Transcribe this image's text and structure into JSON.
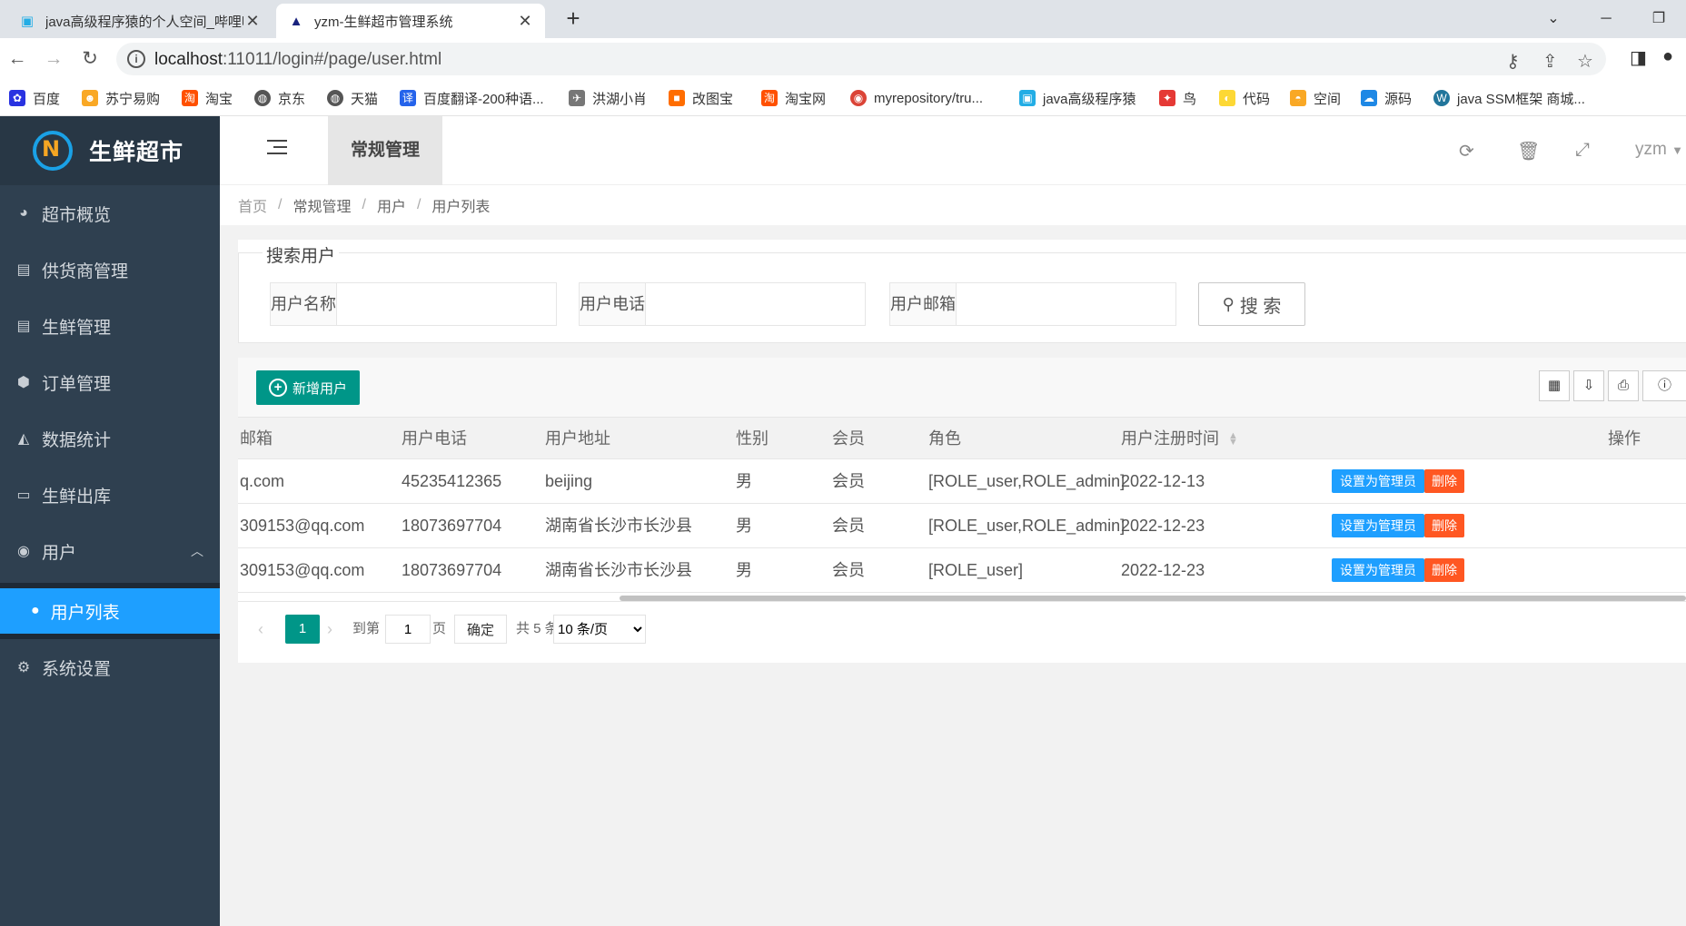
{
  "browser": {
    "tabs": [
      {
        "title": "java高级程序猿的个人空间_哔哩哔哩",
        "icon": "bilibili-icon"
      },
      {
        "title": "yzm-生鲜超市管理系统",
        "icon": "app-icon"
      }
    ],
    "url_host": "localhost",
    "url_rest": ":11011/login#/page/user.html",
    "bookmarks": [
      "百度",
      "苏宁易购",
      "淘宝",
      "京东",
      "天猫",
      "百度翻译-200种语...",
      "洪湖小肖",
      "改图宝",
      "淘宝网",
      "myrepository/tru...",
      "java高级程序猿",
      "鸟",
      "代码",
      "空间",
      "源码",
      "java SSM框架 商城..."
    ]
  },
  "app": {
    "logo_text": "生鲜超市",
    "sidebar": {
      "items": [
        {
          "label": "超市概览",
          "icon": "dashboard-icon"
        },
        {
          "label": "供货商管理",
          "icon": "file-icon"
        },
        {
          "label": "生鲜管理",
          "icon": "file-icon"
        },
        {
          "label": "订单管理",
          "icon": "hexagon-icon"
        },
        {
          "label": "数据统计",
          "icon": "area-chart-icon"
        },
        {
          "label": "生鲜出库",
          "icon": "window-icon"
        },
        {
          "label": "用户",
          "icon": "user-circle-icon"
        },
        {
          "label": "系统设置",
          "icon": "gears-icon"
        }
      ],
      "subitem": {
        "label": "用户列表",
        "icon": "user-icon"
      }
    },
    "topnav": {
      "current": "常规管理",
      "user": "yzm"
    },
    "breadcrumb": [
      "首页",
      "常规管理",
      "用户",
      "用户列表"
    ],
    "search": {
      "legend": "搜索用户",
      "fields": [
        "用户名称",
        "用户电话",
        "用户邮箱"
      ],
      "button": "搜 索"
    },
    "table": {
      "add_button": "新增用户",
      "columns": [
        "邮箱",
        "用户电话",
        "用户地址",
        "性别",
        "会员",
        "角色",
        "用户注册时间",
        "操作"
      ],
      "rows": [
        {
          "email": "q.com",
          "phone": "45235412365",
          "address": "beijing",
          "gender": "男",
          "member": "会员",
          "role": "[ROLE_user,ROLE_admin]",
          "date": "2022-12-13"
        },
        {
          "email": "309153@qq.com",
          "phone": "18073697704",
          "address": "湖南省长沙市长沙县",
          "gender": "男",
          "member": "会员",
          "role": "[ROLE_user,ROLE_admin]",
          "date": "2022-12-23"
        },
        {
          "email": "309153@qq.com",
          "phone": "18073697704",
          "address": "湖南省长沙市长沙县",
          "gender": "男",
          "member": "会员",
          "role": "[ROLE_user]",
          "date": "2022-12-23"
        }
      ],
      "admin_button": "设置为管理员",
      "delete_button": "删除"
    },
    "pager": {
      "current_page": "1",
      "goto_label": "到第",
      "page_input": "1",
      "page_unit": "页",
      "confirm": "确定",
      "total": "共 5 条",
      "page_size": "10 条/页"
    }
  },
  "colors": {
    "sidebar_bg": "#2f4050",
    "active_blue": "#1e9fff",
    "primary_green": "#009688",
    "danger_orange": "#ff5722"
  }
}
